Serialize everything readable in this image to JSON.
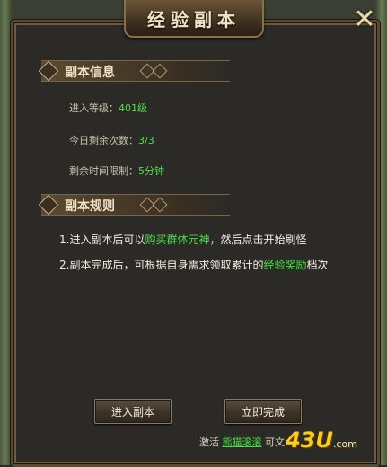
{
  "window": {
    "title": "经验副本",
    "close_glyph": "✕"
  },
  "info_section": {
    "header": "副本信息",
    "rows": [
      {
        "label": "进入等级：",
        "value": "401级"
      },
      {
        "label": "今日剩余次数：",
        "value": "3/3"
      },
      {
        "label": "剩余时间限制：",
        "value": "5分钟"
      }
    ]
  },
  "rules_section": {
    "header": "副本规则",
    "rule1": {
      "before": "1.进入副本后可以",
      "highlight": "购买群体元神",
      "after": "，然后点击开始刷怪"
    },
    "rule2": {
      "before": "2.副本完成后，可根据自身需求领取累计的",
      "highlight": "经验奖励",
      "after": "档次"
    }
  },
  "buttons": {
    "enter": "进入副本",
    "finish": "立即完成"
  },
  "footer": {
    "prefix": "激活",
    "link": "熊猫滚滚",
    "suffix": "可文"
  },
  "watermark": {
    "text": "43U",
    "suffix": ".com"
  },
  "colors": {
    "highlight": "#45e040",
    "value": "#4fe04a",
    "frame": "#5a4a32"
  }
}
